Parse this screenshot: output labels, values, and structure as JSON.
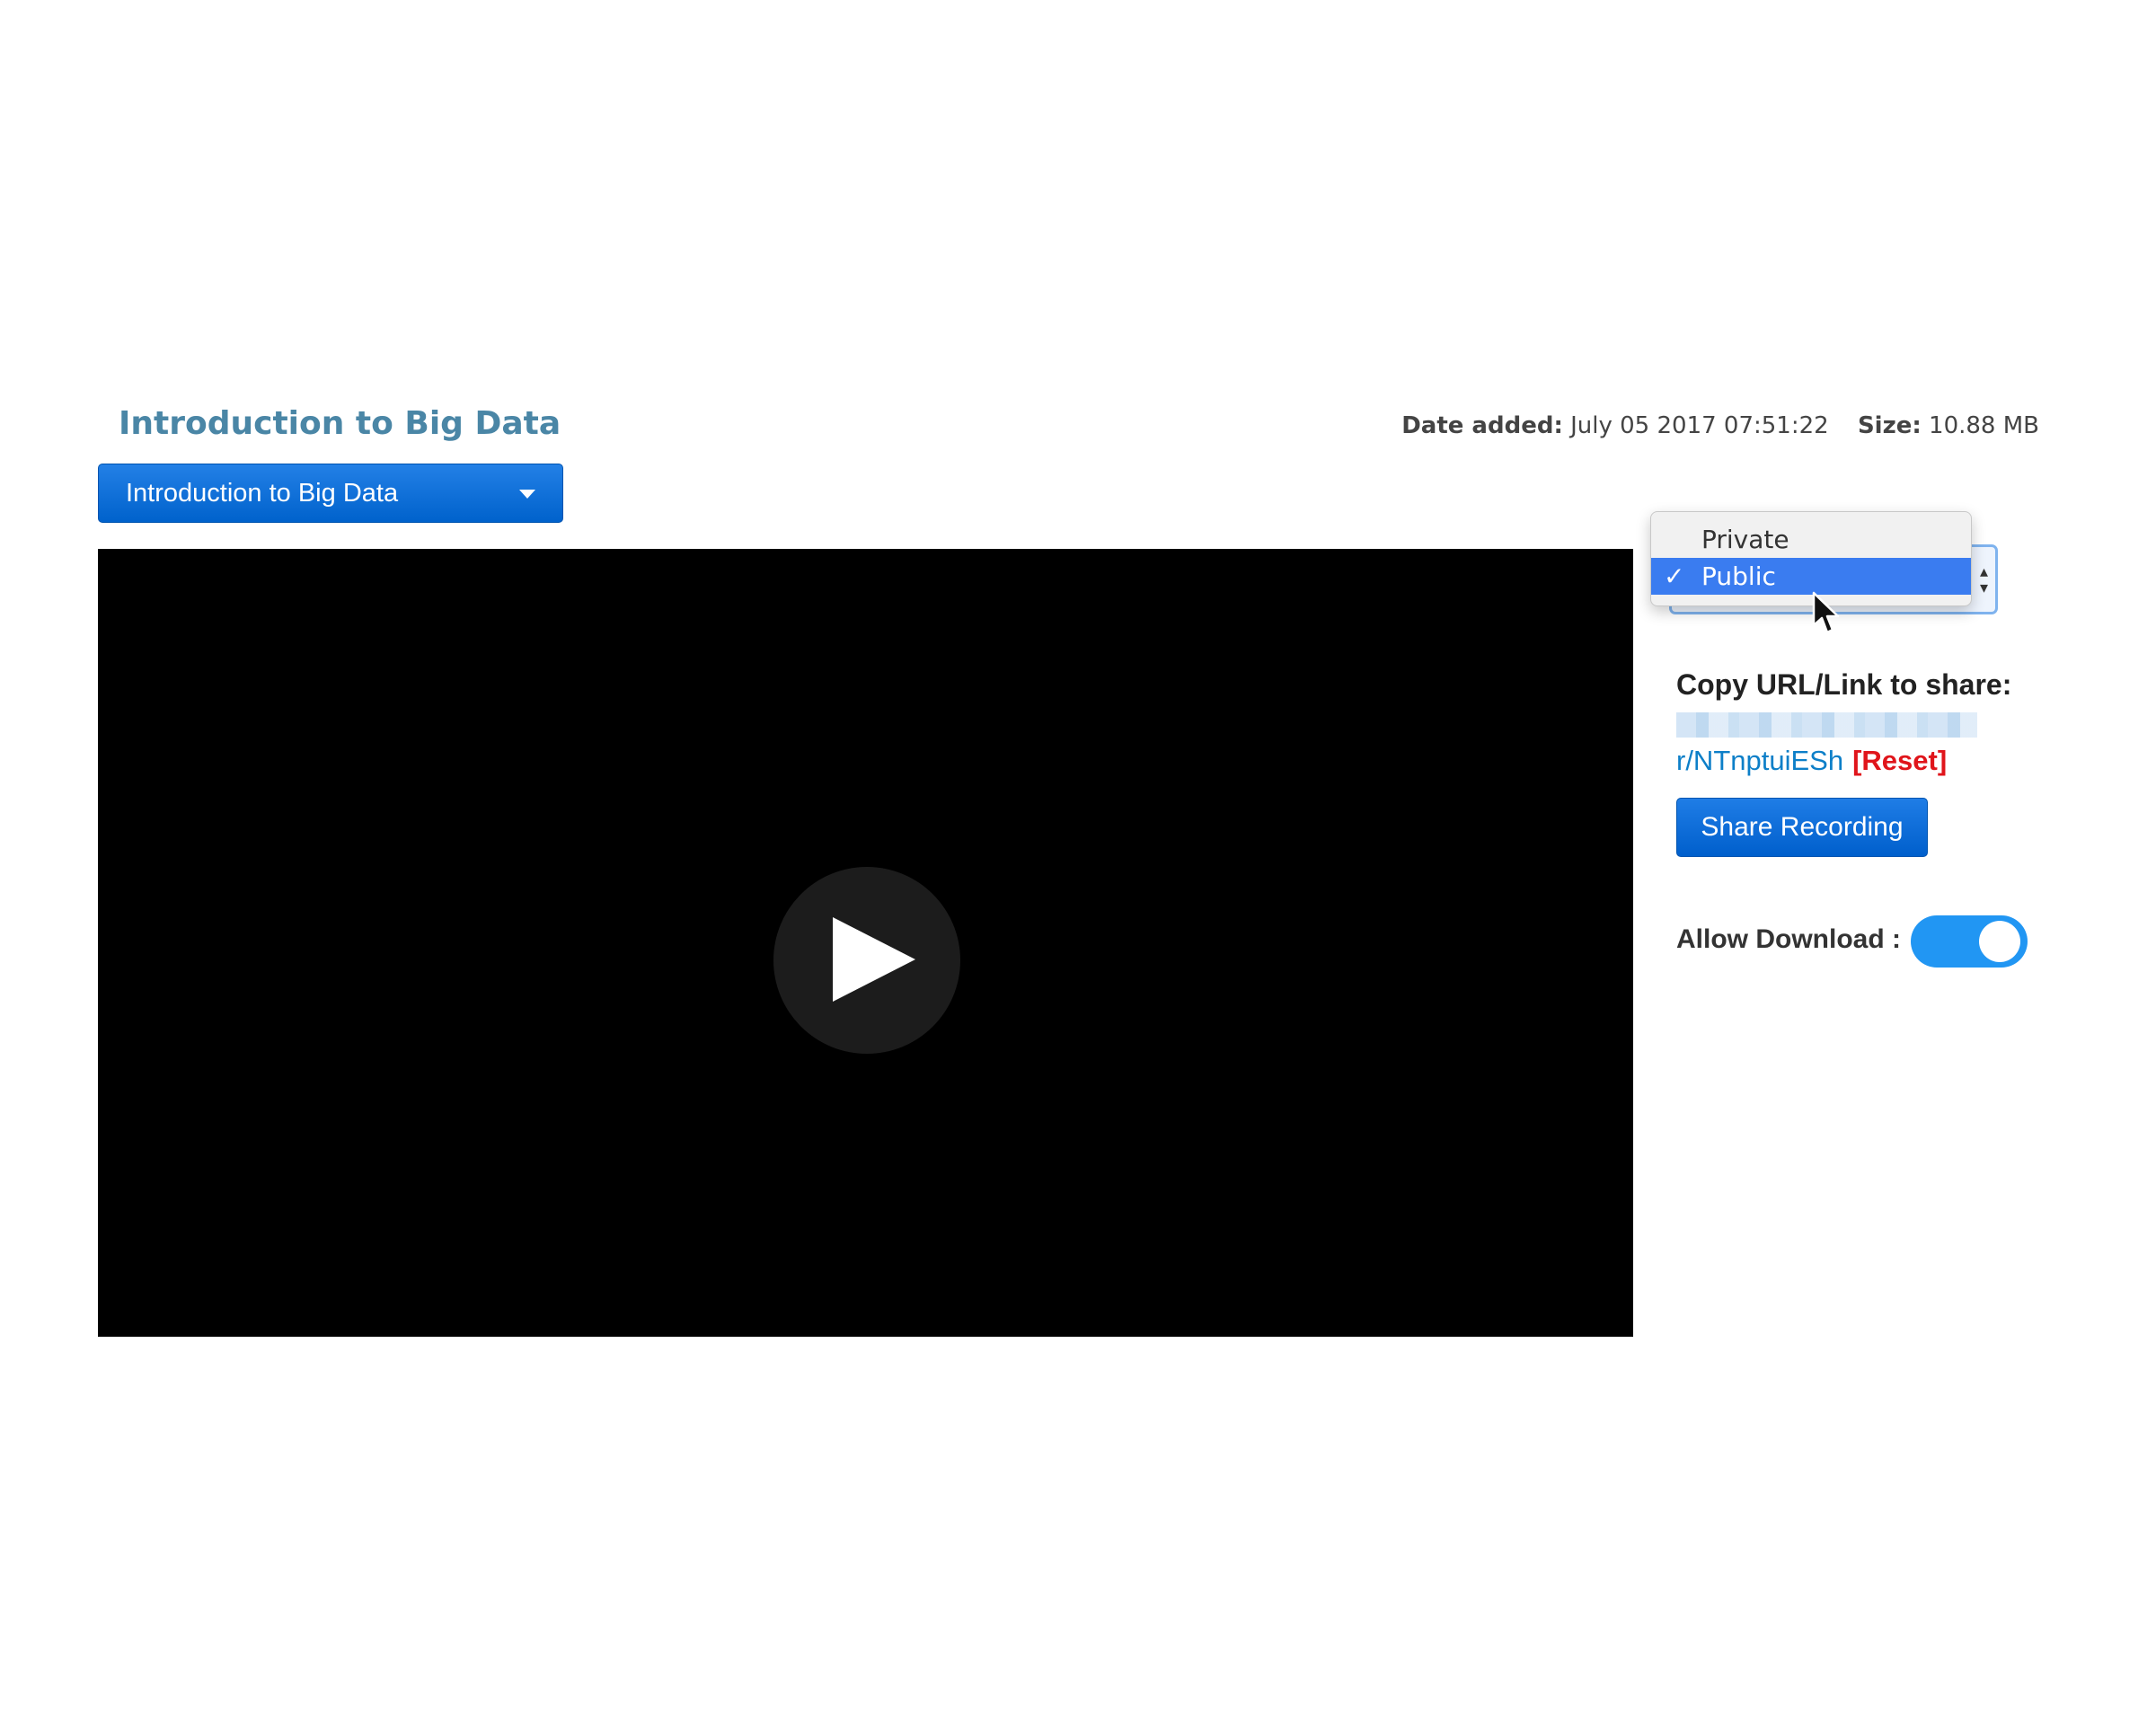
{
  "page": {
    "title": "Introduction to Big Data"
  },
  "meta": {
    "date_label": "Date added:",
    "date_value": "July 05 2017 07:51:22",
    "size_label": "Size:",
    "size_value": "10.88 MB"
  },
  "recording_select": {
    "value": "Introduction to Big Data"
  },
  "video": {
    "play_icon": "play-icon"
  },
  "visibility_select": {
    "options": [
      "Private",
      "Public"
    ],
    "selected": "Public"
  },
  "share": {
    "label": "Copy URL/Link to share:",
    "url_visible_end": "r/NTnptuiESh",
    "reset_label": "[Reset]",
    "button_label": "Share Recording"
  },
  "download": {
    "label": "Allow Download :",
    "enabled": true
  },
  "colors": {
    "title": "#4a86a6",
    "primary_button": "#0062cc",
    "link": "#0d7fc8",
    "reset": "#e0151b",
    "toggle_on": "#2196f3"
  }
}
